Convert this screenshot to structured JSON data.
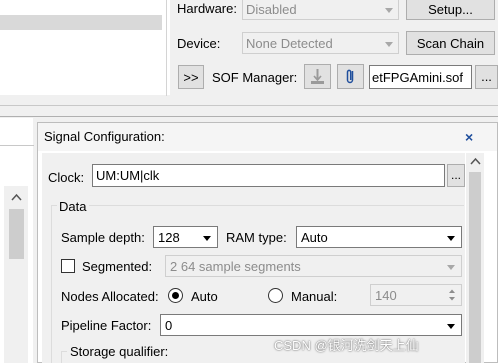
{
  "hardware": {
    "hardware_label": "Hardware:",
    "hardware_value": "Disabled",
    "setup_button": "Setup...",
    "device_label": "Device:",
    "device_value": "None Detected",
    "scan_chain_button": "Scan Chain",
    "expand_button": ">>",
    "sof_label": "SOF Manager:",
    "sof_file": "etFPGAmini.sof",
    "browse_button": "..."
  },
  "signal_config": {
    "title": "Signal Configuration:",
    "close_symbol": "×",
    "clock_label": "Clock:",
    "clock_value": "UM:UM|clk",
    "clock_browse": "...",
    "data_group": "Data",
    "sample_depth_label": "Sample depth:",
    "sample_depth_value": "128",
    "ram_type_label": "RAM type:",
    "ram_type_value": "Auto",
    "segmented_label": "Segmented:",
    "segmented_checked": false,
    "segmented_value": "2  64 sample segments",
    "nodes_allocated_label": "Nodes Allocated:",
    "nodes_auto_label": "Auto",
    "nodes_manual_label": "Manual:",
    "nodes_selected": "Auto",
    "nodes_manual_value": "140",
    "pipeline_label": "Pipeline Factor:",
    "pipeline_value": "0",
    "storage_qualifier_label": "Storage qualifier:"
  },
  "watermark": "CSDN @银河洗剑天上仙",
  "colors": {
    "panel_bg": "#f0f0f0",
    "close_icon": "#1f4e9c"
  }
}
